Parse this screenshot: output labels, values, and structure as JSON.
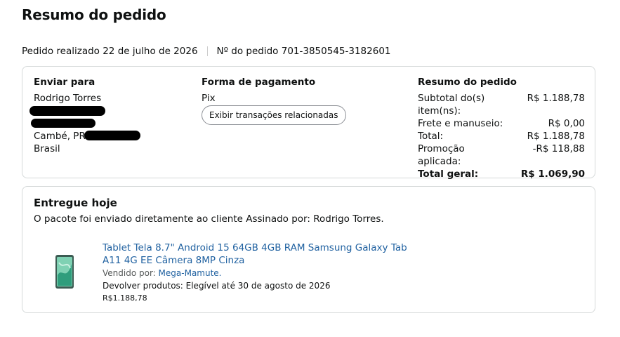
{
  "page": {
    "title": "Resumo do pedido",
    "order_date_text": "Pedido realizado 22 de julho de 2026",
    "order_number_text": "Nº do pedido 701-3850545-3182601"
  },
  "shipping": {
    "heading": "Enviar para",
    "name": "Rodrigo Torres",
    "city_line": "Cambé, PR",
    "country": "Brasil"
  },
  "payment": {
    "heading": "Forma de pagamento",
    "method": "Pix",
    "transactions_button": "Exibir transações relacionadas"
  },
  "summary": {
    "heading": "Resumo do pedido",
    "rows": [
      {
        "label": "Subtotal do(s) item(ns):",
        "value": "R$ 1.188,78"
      },
      {
        "label": "Frete e manuseio:",
        "value": "R$ 0,00"
      },
      {
        "label": "Total:",
        "value": "R$ 1.188,78"
      },
      {
        "label": "Promoção aplicada:",
        "value": "-R$ 118,88"
      }
    ],
    "grand_total_label": "Total geral:",
    "grand_total_value": "R$ 1.069,90"
  },
  "delivery": {
    "heading": "Entregue hoje",
    "note": "O pacote foi enviado diretamente ao cliente Assinado por: Rodrigo Torres.",
    "product": {
      "title": "Tablet Tela 8.7\" Android 15 64GB 4GB RAM Samsung Galaxy Tab A11 4G EE Câmera 8MP Cinza",
      "sold_by_label": "Vendido por:",
      "seller": "Mega-Mamute.",
      "return_text": "Devolver produtos: Elegível até 30 de agosto de 2026",
      "price": "R$1.188,78",
      "thumb_icon": "tablet-icon"
    }
  }
}
